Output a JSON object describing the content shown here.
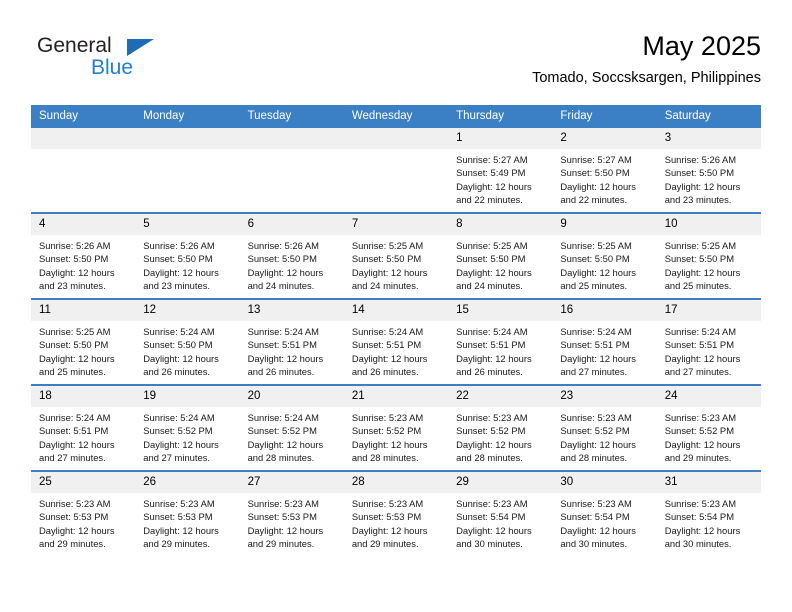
{
  "brand": {
    "name_top": "General",
    "name_bottom": "Blue",
    "triangle_color": "#1d6cb5",
    "blue_color": "#2181d0"
  },
  "header": {
    "month_title": "May 2025",
    "location": "Tomado, Soccsksargen, Philippines"
  },
  "theme": {
    "header_bg": "#3b7fc4",
    "daynum_bg": "#f0f0f0",
    "cell_bg": "#ffffff"
  },
  "weekdays": [
    "Sunday",
    "Monday",
    "Tuesday",
    "Wednesday",
    "Thursday",
    "Friday",
    "Saturday"
  ],
  "weeks": [
    [
      {
        "day": "",
        "empty": true
      },
      {
        "day": "",
        "empty": true
      },
      {
        "day": "",
        "empty": true
      },
      {
        "day": "",
        "empty": true
      },
      {
        "day": "1",
        "sunrise": "Sunrise: 5:27 AM",
        "sunset": "Sunset: 5:49 PM",
        "daylight1": "Daylight: 12 hours",
        "daylight2": "and 22 minutes."
      },
      {
        "day": "2",
        "sunrise": "Sunrise: 5:27 AM",
        "sunset": "Sunset: 5:50 PM",
        "daylight1": "Daylight: 12 hours",
        "daylight2": "and 22 minutes."
      },
      {
        "day": "3",
        "sunrise": "Sunrise: 5:26 AM",
        "sunset": "Sunset: 5:50 PM",
        "daylight1": "Daylight: 12 hours",
        "daylight2": "and 23 minutes."
      }
    ],
    [
      {
        "day": "4",
        "sunrise": "Sunrise: 5:26 AM",
        "sunset": "Sunset: 5:50 PM",
        "daylight1": "Daylight: 12 hours",
        "daylight2": "and 23 minutes."
      },
      {
        "day": "5",
        "sunrise": "Sunrise: 5:26 AM",
        "sunset": "Sunset: 5:50 PM",
        "daylight1": "Daylight: 12 hours",
        "daylight2": "and 23 minutes."
      },
      {
        "day": "6",
        "sunrise": "Sunrise: 5:26 AM",
        "sunset": "Sunset: 5:50 PM",
        "daylight1": "Daylight: 12 hours",
        "daylight2": "and 24 minutes."
      },
      {
        "day": "7",
        "sunrise": "Sunrise: 5:25 AM",
        "sunset": "Sunset: 5:50 PM",
        "daylight1": "Daylight: 12 hours",
        "daylight2": "and 24 minutes."
      },
      {
        "day": "8",
        "sunrise": "Sunrise: 5:25 AM",
        "sunset": "Sunset: 5:50 PM",
        "daylight1": "Daylight: 12 hours",
        "daylight2": "and 24 minutes."
      },
      {
        "day": "9",
        "sunrise": "Sunrise: 5:25 AM",
        "sunset": "Sunset: 5:50 PM",
        "daylight1": "Daylight: 12 hours",
        "daylight2": "and 25 minutes."
      },
      {
        "day": "10",
        "sunrise": "Sunrise: 5:25 AM",
        "sunset": "Sunset: 5:50 PM",
        "daylight1": "Daylight: 12 hours",
        "daylight2": "and 25 minutes."
      }
    ],
    [
      {
        "day": "11",
        "sunrise": "Sunrise: 5:25 AM",
        "sunset": "Sunset: 5:50 PM",
        "daylight1": "Daylight: 12 hours",
        "daylight2": "and 25 minutes."
      },
      {
        "day": "12",
        "sunrise": "Sunrise: 5:24 AM",
        "sunset": "Sunset: 5:50 PM",
        "daylight1": "Daylight: 12 hours",
        "daylight2": "and 26 minutes."
      },
      {
        "day": "13",
        "sunrise": "Sunrise: 5:24 AM",
        "sunset": "Sunset: 5:51 PM",
        "daylight1": "Daylight: 12 hours",
        "daylight2": "and 26 minutes."
      },
      {
        "day": "14",
        "sunrise": "Sunrise: 5:24 AM",
        "sunset": "Sunset: 5:51 PM",
        "daylight1": "Daylight: 12 hours",
        "daylight2": "and 26 minutes."
      },
      {
        "day": "15",
        "sunrise": "Sunrise: 5:24 AM",
        "sunset": "Sunset: 5:51 PM",
        "daylight1": "Daylight: 12 hours",
        "daylight2": "and 26 minutes."
      },
      {
        "day": "16",
        "sunrise": "Sunrise: 5:24 AM",
        "sunset": "Sunset: 5:51 PM",
        "daylight1": "Daylight: 12 hours",
        "daylight2": "and 27 minutes."
      },
      {
        "day": "17",
        "sunrise": "Sunrise: 5:24 AM",
        "sunset": "Sunset: 5:51 PM",
        "daylight1": "Daylight: 12 hours",
        "daylight2": "and 27 minutes."
      }
    ],
    [
      {
        "day": "18",
        "sunrise": "Sunrise: 5:24 AM",
        "sunset": "Sunset: 5:51 PM",
        "daylight1": "Daylight: 12 hours",
        "daylight2": "and 27 minutes."
      },
      {
        "day": "19",
        "sunrise": "Sunrise: 5:24 AM",
        "sunset": "Sunset: 5:52 PM",
        "daylight1": "Daylight: 12 hours",
        "daylight2": "and 27 minutes."
      },
      {
        "day": "20",
        "sunrise": "Sunrise: 5:24 AM",
        "sunset": "Sunset: 5:52 PM",
        "daylight1": "Daylight: 12 hours",
        "daylight2": "and 28 minutes."
      },
      {
        "day": "21",
        "sunrise": "Sunrise: 5:23 AM",
        "sunset": "Sunset: 5:52 PM",
        "daylight1": "Daylight: 12 hours",
        "daylight2": "and 28 minutes."
      },
      {
        "day": "22",
        "sunrise": "Sunrise: 5:23 AM",
        "sunset": "Sunset: 5:52 PM",
        "daylight1": "Daylight: 12 hours",
        "daylight2": "and 28 minutes."
      },
      {
        "day": "23",
        "sunrise": "Sunrise: 5:23 AM",
        "sunset": "Sunset: 5:52 PM",
        "daylight1": "Daylight: 12 hours",
        "daylight2": "and 28 minutes."
      },
      {
        "day": "24",
        "sunrise": "Sunrise: 5:23 AM",
        "sunset": "Sunset: 5:52 PM",
        "daylight1": "Daylight: 12 hours",
        "daylight2": "and 29 minutes."
      }
    ],
    [
      {
        "day": "25",
        "sunrise": "Sunrise: 5:23 AM",
        "sunset": "Sunset: 5:53 PM",
        "daylight1": "Daylight: 12 hours",
        "daylight2": "and 29 minutes."
      },
      {
        "day": "26",
        "sunrise": "Sunrise: 5:23 AM",
        "sunset": "Sunset: 5:53 PM",
        "daylight1": "Daylight: 12 hours",
        "daylight2": "and 29 minutes."
      },
      {
        "day": "27",
        "sunrise": "Sunrise: 5:23 AM",
        "sunset": "Sunset: 5:53 PM",
        "daylight1": "Daylight: 12 hours",
        "daylight2": "and 29 minutes."
      },
      {
        "day": "28",
        "sunrise": "Sunrise: 5:23 AM",
        "sunset": "Sunset: 5:53 PM",
        "daylight1": "Daylight: 12 hours",
        "daylight2": "and 29 minutes."
      },
      {
        "day": "29",
        "sunrise": "Sunrise: 5:23 AM",
        "sunset": "Sunset: 5:54 PM",
        "daylight1": "Daylight: 12 hours",
        "daylight2": "and 30 minutes."
      },
      {
        "day": "30",
        "sunrise": "Sunrise: 5:23 AM",
        "sunset": "Sunset: 5:54 PM",
        "daylight1": "Daylight: 12 hours",
        "daylight2": "and 30 minutes."
      },
      {
        "day": "31",
        "sunrise": "Sunrise: 5:23 AM",
        "sunset": "Sunset: 5:54 PM",
        "daylight1": "Daylight: 12 hours",
        "daylight2": "and 30 minutes."
      }
    ]
  ]
}
